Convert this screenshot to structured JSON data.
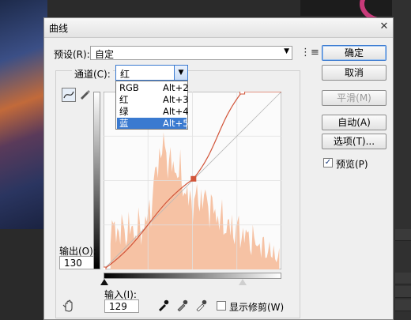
{
  "dialog": {
    "title": "曲线",
    "close": "✕"
  },
  "preset": {
    "label": "预设(R):",
    "value": "自定"
  },
  "channel": {
    "label": "通道(C):",
    "value": "红",
    "options": [
      {
        "name": "RGB",
        "shortcut": "Alt+2"
      },
      {
        "name": "红",
        "shortcut": "Alt+3"
      },
      {
        "name": "绿",
        "shortcut": "Alt+4"
      },
      {
        "name": "蓝",
        "shortcut": "Alt+5"
      }
    ],
    "highlighted": "蓝"
  },
  "buttons": {
    "ok": "确定",
    "cancel": "取消",
    "smooth": "平滑(M)",
    "auto": "自动(A)",
    "options": "选项(T)..."
  },
  "preview": {
    "label": "预览(P)",
    "checked": true
  },
  "output": {
    "label": "输出(O):",
    "value": "130"
  },
  "input": {
    "label": "输入(I):",
    "value": "129"
  },
  "show_clipping": {
    "label": "显示修剪(W)",
    "checked": false
  },
  "colors": {
    "curve": "#d2553a",
    "histogram": "#f6c2a4",
    "accent": "#3a7ad0"
  },
  "curve_points": [
    [
      0,
      0
    ],
    [
      129,
      130
    ],
    [
      199,
      255
    ],
    [
      255,
      255
    ]
  ]
}
